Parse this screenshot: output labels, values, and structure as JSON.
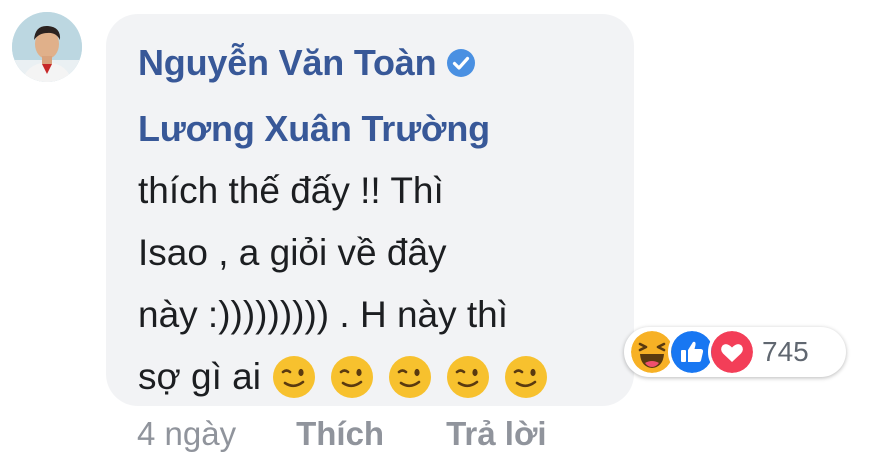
{
  "comment": {
    "author": "Nguyễn Văn Toàn",
    "mention": "Lương Xuân Trường",
    "lines": [
      "thích thế đấy !! Thì",
      "Isao , a giỏi về đây",
      "này :))))))))) . H này thì",
      "sợ gì ai"
    ],
    "emojis": [
      "winking-face",
      "winking-face",
      "winking-face",
      "winking-face",
      "winking-face"
    ]
  },
  "reactions": {
    "icons": [
      "haha-icon",
      "like-icon",
      "love-icon"
    ],
    "count": "745"
  },
  "actions": {
    "time": "4 ngày",
    "like_label": "Thích",
    "reply_label": "Trả lời"
  },
  "colors": {
    "author": "#385898",
    "bubble": "#f2f3f5",
    "meta": "#90949c",
    "like_blue": "#1877f2",
    "love_red": "#f33e58",
    "haha_yellow": "#f7b125"
  }
}
